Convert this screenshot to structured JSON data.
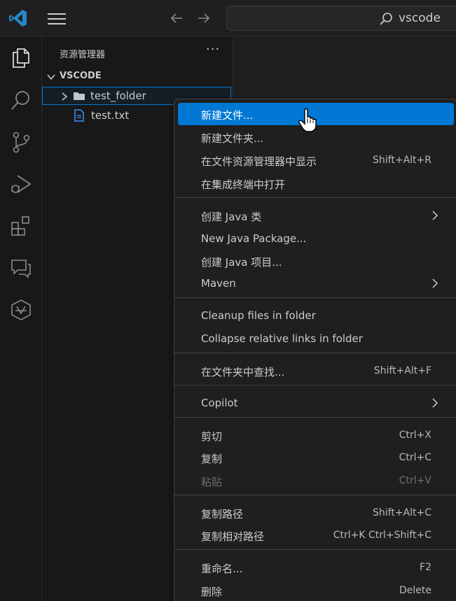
{
  "titlebar": {
    "command_center_text": "vscode"
  },
  "sidebar": {
    "title": "资源管理器",
    "more": "···",
    "workspace_name": "VSCODE",
    "tree": [
      {
        "label": "test_folder",
        "type": "folder"
      },
      {
        "label": "test.txt",
        "type": "file"
      }
    ]
  },
  "context_menu": {
    "groups": [
      [
        {
          "label": "新建文件...",
          "shortcut": "",
          "active": true
        },
        {
          "label": "新建文件夹...",
          "shortcut": ""
        },
        {
          "label": "在文件资源管理器中显示",
          "shortcut": "Shift+Alt+R"
        },
        {
          "label": "在集成终端中打开",
          "shortcut": ""
        }
      ],
      [
        {
          "label": "创建 Java 类",
          "shortcut": "",
          "submenu": true
        },
        {
          "label": "New Java Package...",
          "shortcut": ""
        },
        {
          "label": "创建 Java 项目...",
          "shortcut": ""
        },
        {
          "label": "Maven",
          "shortcut": "",
          "submenu": true
        }
      ],
      [
        {
          "label": "Cleanup files in folder",
          "shortcut": ""
        },
        {
          "label": "Collapse relative links in folder",
          "shortcut": ""
        }
      ],
      [
        {
          "label": "在文件夹中查找...",
          "shortcut": "Shift+Alt+F"
        }
      ],
      [
        {
          "label": "Copilot",
          "shortcut": "",
          "submenu": true
        }
      ],
      [
        {
          "label": "剪切",
          "shortcut": "Ctrl+X"
        },
        {
          "label": "复制",
          "shortcut": "Ctrl+C"
        },
        {
          "label": "粘贴",
          "shortcut": "Ctrl+V",
          "disabled": true
        }
      ],
      [
        {
          "label": "复制路径",
          "shortcut": "Shift+Alt+C"
        },
        {
          "label": "复制相对路径",
          "shortcut": "Ctrl+K Ctrl+Shift+C"
        }
      ],
      [
        {
          "label": "重命名...",
          "shortcut": "F2"
        },
        {
          "label": "删除",
          "shortcut": "Delete"
        }
      ]
    ]
  },
  "colors": {
    "accent": "#0078d4",
    "background": "#1f1f1f",
    "sidebar": "#181818",
    "file_icon": "#3794ff"
  }
}
